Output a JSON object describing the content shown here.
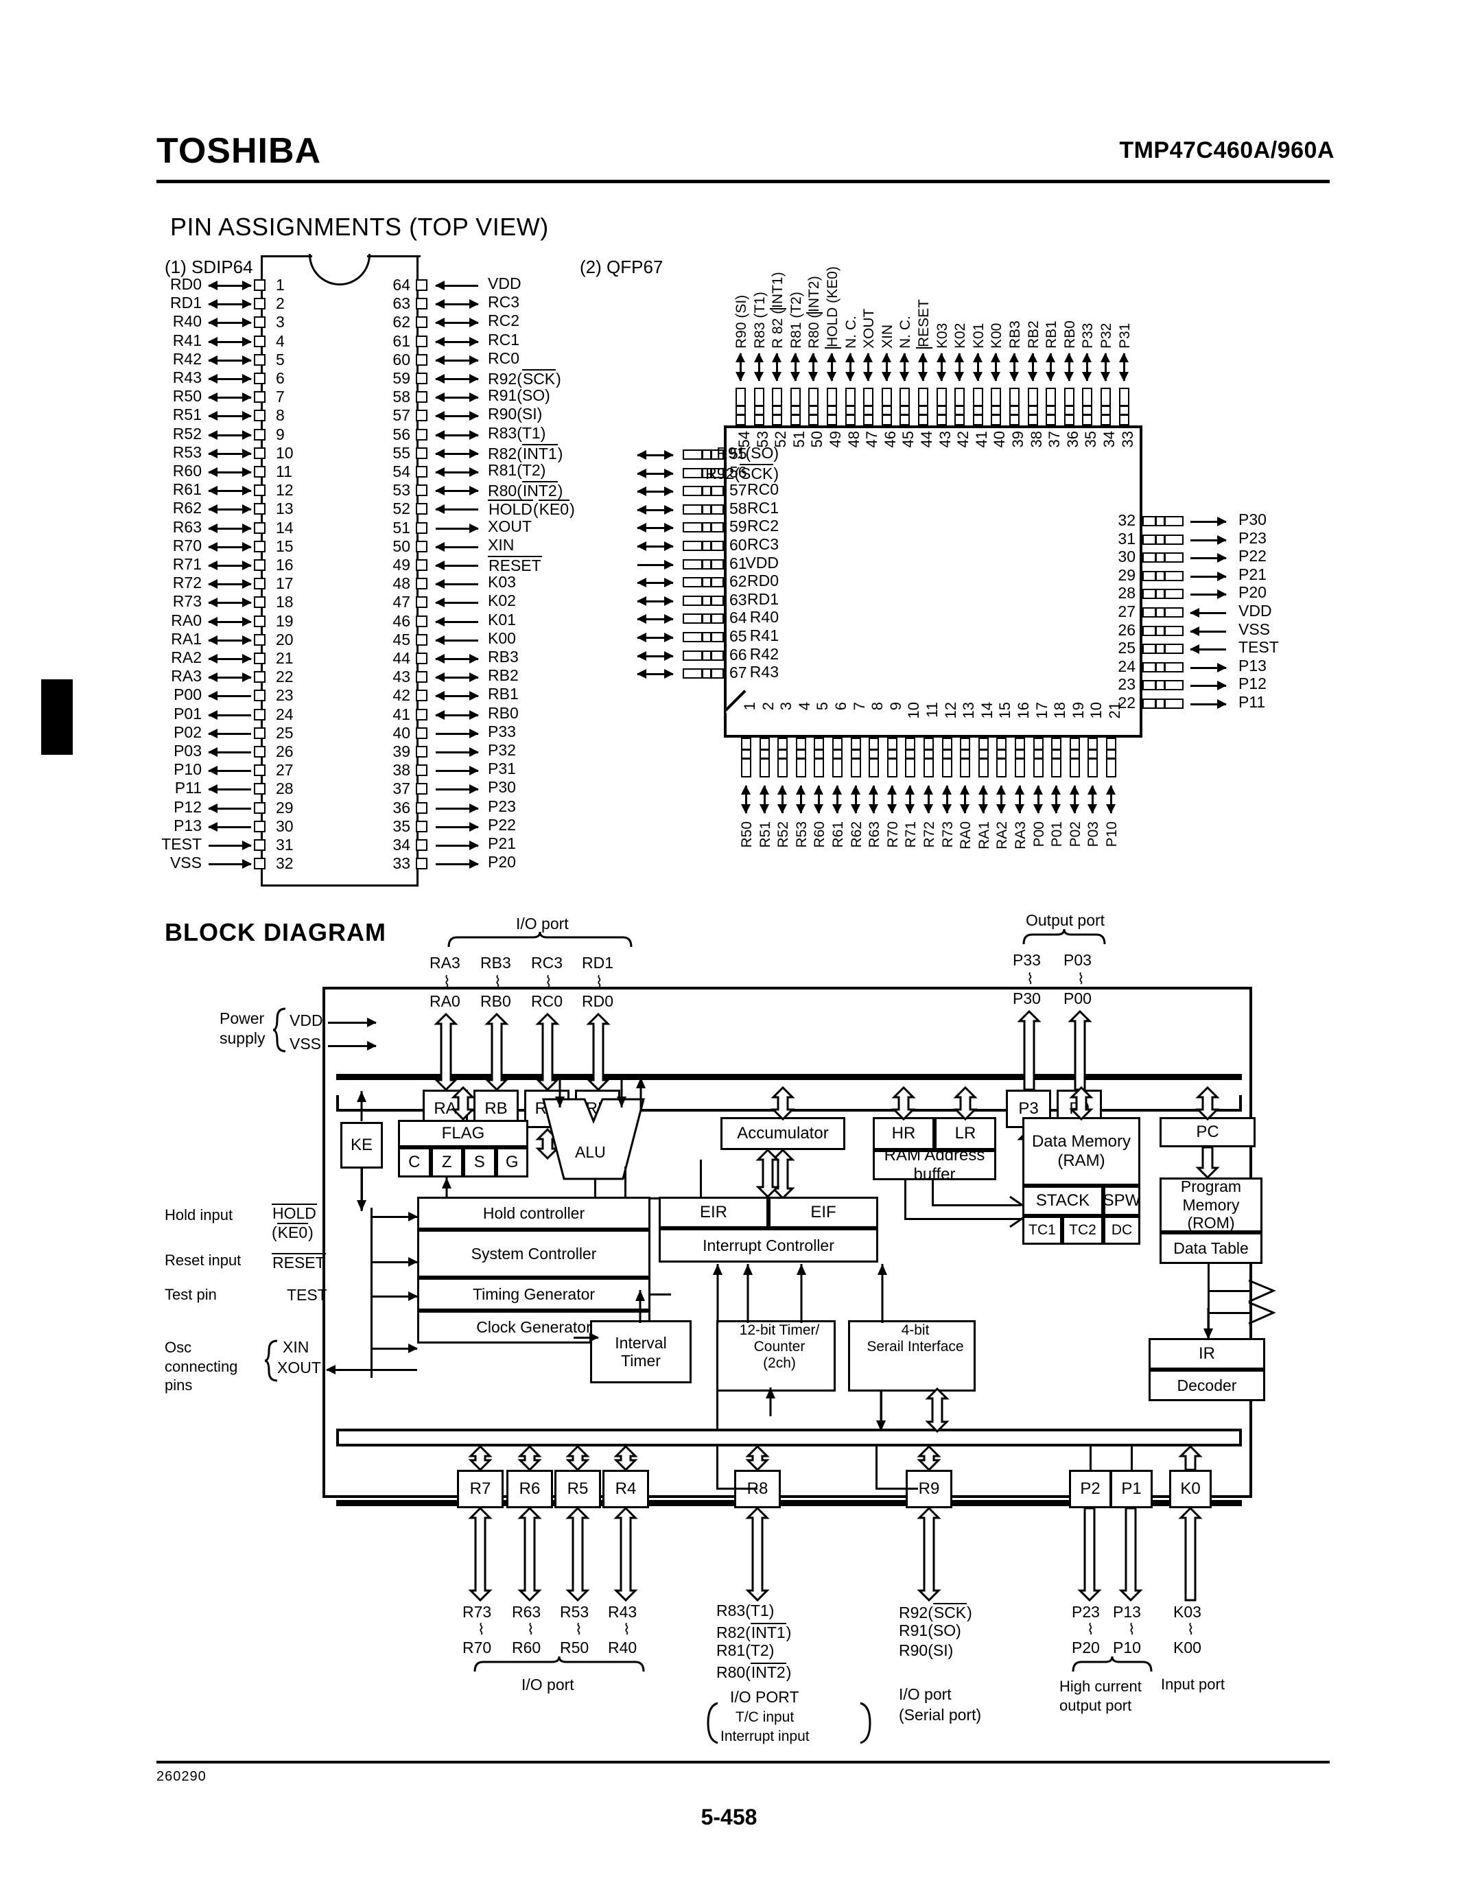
{
  "header": {
    "brand": "TOSHIBA",
    "part_number": "TMP47C460A/960A"
  },
  "footer": {
    "doc_code": "260290",
    "page_number": "5-458"
  },
  "sections": {
    "pin_assignments_title": "PIN ASSIGNMENTS (TOP VIEW)",
    "block_diagram_title": "BLOCK DIAGRAM",
    "sdip_caption": "(1)  SDIP64",
    "qfp_caption": "(2)  QFP67"
  },
  "sdip64": {
    "left": [
      {
        "pin": "1",
        "name": "RD0",
        "dir": "bi"
      },
      {
        "pin": "2",
        "name": "RD1",
        "dir": "bi"
      },
      {
        "pin": "3",
        "name": "R40",
        "dir": "bi"
      },
      {
        "pin": "4",
        "name": "R41",
        "dir": "bi"
      },
      {
        "pin": "5",
        "name": "R42",
        "dir": "bi"
      },
      {
        "pin": "6",
        "name": "R43",
        "dir": "bi"
      },
      {
        "pin": "7",
        "name": "R50",
        "dir": "bi"
      },
      {
        "pin": "8",
        "name": "R51",
        "dir": "bi"
      },
      {
        "pin": "9",
        "name": "R52",
        "dir": "bi"
      },
      {
        "pin": "10",
        "name": "R53",
        "dir": "bi"
      },
      {
        "pin": "11",
        "name": "R60",
        "dir": "bi"
      },
      {
        "pin": "12",
        "name": "R61",
        "dir": "bi"
      },
      {
        "pin": "13",
        "name": "R62",
        "dir": "bi"
      },
      {
        "pin": "14",
        "name": "R63",
        "dir": "bi"
      },
      {
        "pin": "15",
        "name": "R70",
        "dir": "bi"
      },
      {
        "pin": "16",
        "name": "R71",
        "dir": "bi"
      },
      {
        "pin": "17",
        "name": "R72",
        "dir": "bi"
      },
      {
        "pin": "18",
        "name": "R73",
        "dir": "bi"
      },
      {
        "pin": "19",
        "name": "RA0",
        "dir": "bi"
      },
      {
        "pin": "20",
        "name": "RA1",
        "dir": "bi"
      },
      {
        "pin": "21",
        "name": "RA2",
        "dir": "bi"
      },
      {
        "pin": "22",
        "name": "RA3",
        "dir": "bi"
      },
      {
        "pin": "23",
        "name": "P00",
        "dir": "out"
      },
      {
        "pin": "24",
        "name": "P01",
        "dir": "out"
      },
      {
        "pin": "25",
        "name": "P02",
        "dir": "out"
      },
      {
        "pin": "26",
        "name": "P03",
        "dir": "out"
      },
      {
        "pin": "27",
        "name": "P10",
        "dir": "out"
      },
      {
        "pin": "28",
        "name": "P11",
        "dir": "out"
      },
      {
        "pin": "29",
        "name": "P12",
        "dir": "out"
      },
      {
        "pin": "30",
        "name": "P13",
        "dir": "out"
      },
      {
        "pin": "31",
        "name": "TEST",
        "dir": "in"
      },
      {
        "pin": "32",
        "name": "VSS",
        "dir": "in"
      }
    ],
    "right": [
      {
        "pin": "64",
        "name": "VDD",
        "dir": "in"
      },
      {
        "pin": "63",
        "name": "RC3",
        "dir": "bi"
      },
      {
        "pin": "62",
        "name": "RC2",
        "dir": "bi"
      },
      {
        "pin": "61",
        "name": "RC1",
        "dir": "bi"
      },
      {
        "pin": "60",
        "name": "RC0",
        "dir": "bi"
      },
      {
        "pin": "59",
        "name": "R92(SCK)",
        "dir": "bi",
        "bar": "SCK"
      },
      {
        "pin": "58",
        "name": "R91(SO)",
        "dir": "bi"
      },
      {
        "pin": "57",
        "name": "R90(SI)",
        "dir": "bi"
      },
      {
        "pin": "56",
        "name": "R83(T1)",
        "dir": "bi"
      },
      {
        "pin": "55",
        "name": "R82(INT1)",
        "dir": "bi",
        "bar": "INT1"
      },
      {
        "pin": "54",
        "name": "R81(T2)",
        "dir": "bi"
      },
      {
        "pin": "53",
        "name": "R80(INT2)",
        "dir": "bi",
        "bar": "INT2"
      },
      {
        "pin": "52",
        "name": "HOLD(KE0)",
        "dir": "in",
        "bar": "both"
      },
      {
        "pin": "51",
        "name": "XOUT",
        "dir": "out"
      },
      {
        "pin": "50",
        "name": "XIN",
        "dir": "in"
      },
      {
        "pin": "49",
        "name": "RESET",
        "dir": "in",
        "bar": "RESET"
      },
      {
        "pin": "48",
        "name": "K03",
        "dir": "in"
      },
      {
        "pin": "47",
        "name": "K02",
        "dir": "in"
      },
      {
        "pin": "46",
        "name": "K01",
        "dir": "in"
      },
      {
        "pin": "45",
        "name": "K00",
        "dir": "in"
      },
      {
        "pin": "44",
        "name": "RB3",
        "dir": "bi"
      },
      {
        "pin": "43",
        "name": "RB2",
        "dir": "bi"
      },
      {
        "pin": "42",
        "name": "RB1",
        "dir": "bi"
      },
      {
        "pin": "41",
        "name": "RB0",
        "dir": "bi"
      },
      {
        "pin": "40",
        "name": "P33",
        "dir": "out"
      },
      {
        "pin": "39",
        "name": "P32",
        "dir": "out"
      },
      {
        "pin": "38",
        "name": "P31",
        "dir": "out"
      },
      {
        "pin": "37",
        "name": "P30",
        "dir": "out"
      },
      {
        "pin": "36",
        "name": "P23",
        "dir": "out"
      },
      {
        "pin": "35",
        "name": "P22",
        "dir": "out"
      },
      {
        "pin": "34",
        "name": "P21",
        "dir": "out"
      },
      {
        "pin": "33",
        "name": "P20",
        "dir": "out"
      }
    ]
  },
  "qfp67": {
    "top": [
      {
        "pin": "54",
        "name": "R90 (SI)"
      },
      {
        "pin": "53",
        "name": "R83 (T1)"
      },
      {
        "pin": "52",
        "name": "R 82 (INT1)",
        "bar": "INT1"
      },
      {
        "pin": "51",
        "name": "R81 (T2)"
      },
      {
        "pin": "50",
        "name": "R80 (INT2)",
        "bar": "INT2"
      },
      {
        "pin": "49",
        "name": "HOLD (KE0)",
        "bar": "both"
      },
      {
        "pin": "48",
        "name": "N. C."
      },
      {
        "pin": "47",
        "name": "XOUT"
      },
      {
        "pin": "46",
        "name": "XIN"
      },
      {
        "pin": "45",
        "name": "N. C."
      },
      {
        "pin": "44",
        "name": "RESET",
        "bar": "RESET"
      },
      {
        "pin": "43",
        "name": "K03"
      },
      {
        "pin": "42",
        "name": "K02"
      },
      {
        "pin": "41",
        "name": "K01"
      },
      {
        "pin": "40",
        "name": "K00"
      },
      {
        "pin": "39",
        "name": "RB3"
      },
      {
        "pin": "38",
        "name": "RB2"
      },
      {
        "pin": "37",
        "name": "RB1"
      },
      {
        "pin": "36",
        "name": "RB0"
      },
      {
        "pin": "35",
        "name": "P33"
      },
      {
        "pin": "34",
        "name": "P32"
      },
      {
        "pin": "33",
        "name": "P31"
      }
    ],
    "left": [
      {
        "pin": "55",
        "name": "R91(SO)",
        "dir": "bi"
      },
      {
        "pin": "56",
        "name": "R92(SCK)",
        "dir": "bi",
        "bar": "SCK"
      },
      {
        "pin": "57",
        "name": "RC0",
        "dir": "bi"
      },
      {
        "pin": "58",
        "name": "RC1",
        "dir": "bi"
      },
      {
        "pin": "59",
        "name": "RC2",
        "dir": "bi"
      },
      {
        "pin": "60",
        "name": "RC3",
        "dir": "bi"
      },
      {
        "pin": "61",
        "name": "VDD",
        "dir": "in"
      },
      {
        "pin": "62",
        "name": "RD0",
        "dir": "bi"
      },
      {
        "pin": "63",
        "name": "RD1",
        "dir": "bi"
      },
      {
        "pin": "64",
        "name": "R40",
        "dir": "bi"
      },
      {
        "pin": "65",
        "name": "R41",
        "dir": "bi"
      },
      {
        "pin": "66",
        "name": "R42",
        "dir": "bi"
      },
      {
        "pin": "67",
        "name": "R43",
        "dir": "bi"
      }
    ],
    "right": [
      {
        "pin": "32",
        "name": "P30",
        "dir": "out"
      },
      {
        "pin": "31",
        "name": "P23",
        "dir": "out"
      },
      {
        "pin": "30",
        "name": "P22",
        "dir": "out"
      },
      {
        "pin": "29",
        "name": "P21",
        "dir": "out"
      },
      {
        "pin": "28",
        "name": "P20",
        "dir": "out"
      },
      {
        "pin": "27",
        "name": "VDD",
        "dir": "in"
      },
      {
        "pin": "26",
        "name": "VSS",
        "dir": "in"
      },
      {
        "pin": "25",
        "name": "TEST",
        "dir": "in"
      },
      {
        "pin": "24",
        "name": "P13",
        "dir": "out"
      },
      {
        "pin": "23",
        "name": "P12",
        "dir": "out"
      },
      {
        "pin": "22",
        "name": "P11",
        "dir": "out"
      }
    ],
    "bottom": [
      {
        "pin": "1",
        "name": "R50"
      },
      {
        "pin": "2",
        "name": "R51"
      },
      {
        "pin": "3",
        "name": "R52"
      },
      {
        "pin": "4",
        "name": "R53"
      },
      {
        "pin": "5",
        "name": "R60"
      },
      {
        "pin": "6",
        "name": "R61"
      },
      {
        "pin": "7",
        "name": "R62"
      },
      {
        "pin": "8",
        "name": "R63"
      },
      {
        "pin": "9",
        "name": "R70"
      },
      {
        "pin": "10",
        "name": "R71"
      },
      {
        "pin": "11",
        "name": "R72"
      },
      {
        "pin": "12",
        "name": "R73"
      },
      {
        "pin": "13",
        "name": "RA0"
      },
      {
        "pin": "14",
        "name": "RA1"
      },
      {
        "pin": "15",
        "name": "RA2"
      },
      {
        "pin": "16",
        "name": "RA3"
      },
      {
        "pin": "17",
        "name": "P00"
      },
      {
        "pin": "18",
        "name": "P01"
      },
      {
        "pin": "19",
        "name": "P02"
      },
      {
        "pin": "10",
        "name": "P03"
      },
      {
        "pin": "21",
        "name": "P10"
      }
    ]
  },
  "block_diagram": {
    "top_io_group_label": "I/O port",
    "top_output_group_label": "Output port",
    "top_ports": [
      {
        "hi": "RA3",
        "lo": "RA0",
        "box": "RA"
      },
      {
        "hi": "RB3",
        "lo": "RB0",
        "box": "RB"
      },
      {
        "hi": "RC3",
        "lo": "RC0",
        "box": "RC"
      },
      {
        "hi": "RD1",
        "lo": "RD0",
        "box": "RD"
      }
    ],
    "top_out_ports": [
      {
        "hi": "P33",
        "lo": "P30",
        "box": "P3"
      },
      {
        "hi": "P03",
        "lo": "P00",
        "box": "P0"
      }
    ],
    "power_supply_label": "Power\nsupply",
    "power_pins": [
      "VDD",
      "VSS"
    ],
    "left_signals": [
      {
        "label": "Hold input",
        "pin1": "HOLD",
        "pin2": "(KE0)"
      },
      {
        "label": "Reset input",
        "pin1": "RESET"
      },
      {
        "label": "Test pin",
        "pin1": "TEST"
      }
    ],
    "osc_label": "Osc\nconnecting\npins",
    "osc_pins": [
      "XIN",
      "XOUT"
    ],
    "boxes": {
      "ke": "KE",
      "flag": "FLAG",
      "flag_bits": [
        "C",
        "Z",
        "S",
        "G"
      ],
      "alu": "ALU",
      "accumulator": "Accumulator",
      "hr": "HR",
      "lr": "LR",
      "ram_addr_buffer": "RAM Address buffer",
      "data_memory": "Data Memory",
      "data_memory_sub": "(RAM)",
      "stack": "STACK",
      "spw": "SPW",
      "tc1": "TC1",
      "tc2": "TC2",
      "dc": "DC",
      "pc": "PC",
      "program_memory": "Program Memory",
      "program_memory_sub": "(ROM)",
      "data_table": "Data Table",
      "ir": "IR",
      "decoder": "Decoder",
      "hold_controller": "Hold controller",
      "system_controller": "System Controller",
      "timing_generator": "Timing Generator",
      "clock_generator": "Clock Generator",
      "eir": "EIR",
      "eif": "EIF",
      "interrupt_controller": "Interrupt Controller",
      "interval_timer": "Interval\nTimer",
      "timer_counter": "12-bit Timer/\nCounter\n(2ch)",
      "serial_interface": "4-bit\nSerail Interface"
    },
    "bottom_ports": [
      {
        "box": "R7",
        "hi": "R73",
        "lo": "R70"
      },
      {
        "box": "R6",
        "hi": "R63",
        "lo": "R60"
      },
      {
        "box": "R5",
        "hi": "R53",
        "lo": "R50"
      },
      {
        "box": "R4",
        "hi": "R43",
        "lo": "R40"
      }
    ],
    "bottom_io_label": "I/O port",
    "r8_box": "R8",
    "r8_pins": [
      "R83(T1)",
      "R82(INT1)",
      "R81(T2)",
      "R80(INT2)"
    ],
    "r8_group": [
      "I/O PORT",
      "T/C input",
      "Interrupt input"
    ],
    "r9_box": "R9",
    "r9_pins": [
      "R92(SCK)",
      "R91(SO)",
      "R90(SI)"
    ],
    "r9_group": [
      "I/O port",
      "(Serial port)"
    ],
    "p_ports": [
      {
        "box": "P2",
        "hi": "P23",
        "lo": "P20"
      },
      {
        "box": "P1",
        "hi": "P13",
        "lo": "P10"
      }
    ],
    "p_group": "High current\noutput port",
    "k_port": {
      "box": "K0",
      "hi": "K03",
      "lo": "K00",
      "group": "Input port"
    }
  }
}
